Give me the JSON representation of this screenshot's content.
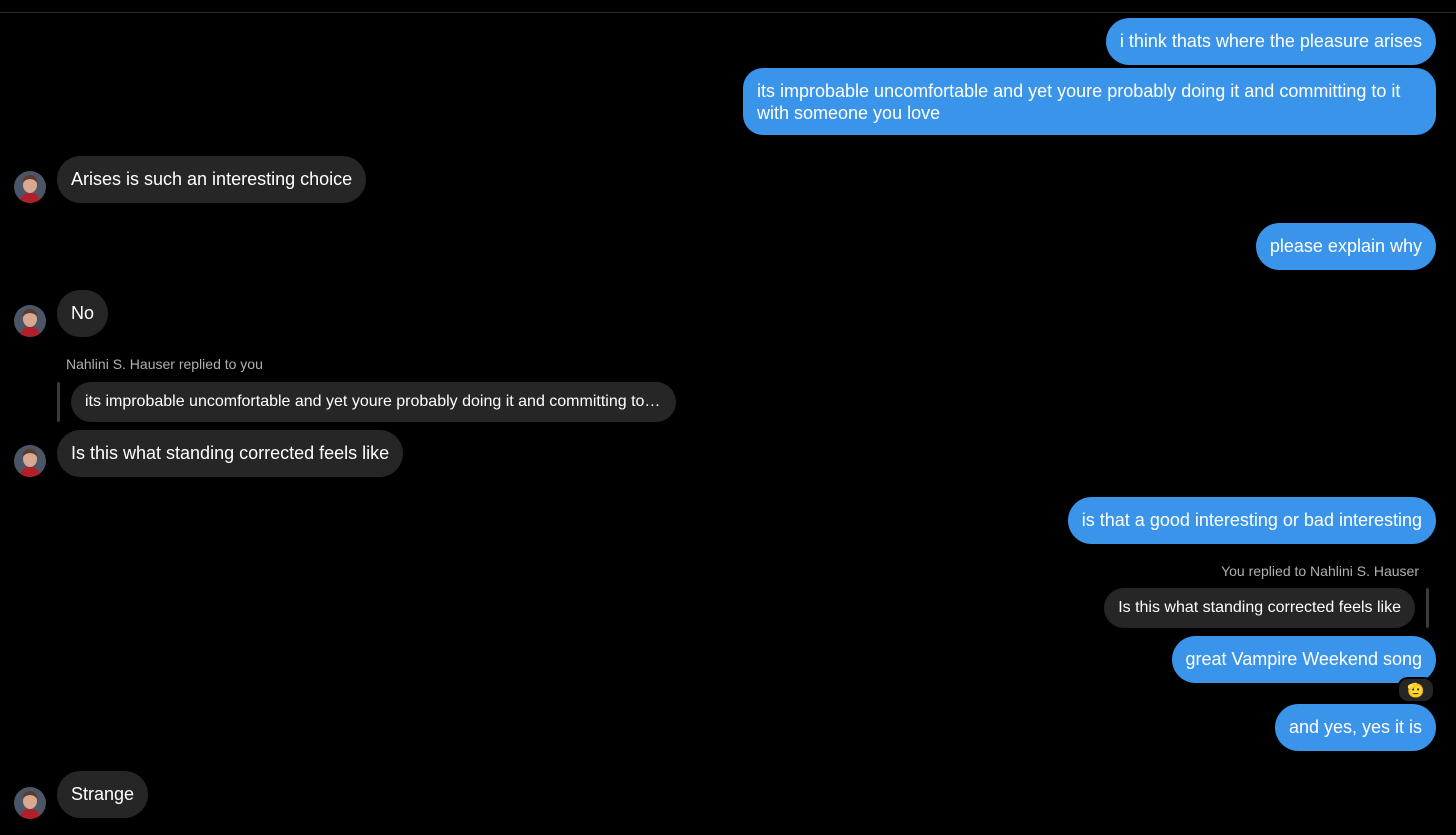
{
  "contact": {
    "name": "Nahlini S. Hauser"
  },
  "messages": {
    "m1": "i think thats where the pleasure arises",
    "m2": "its improbable uncomfortable and yet youre probably doing it and committing to it with someone you love",
    "m3": "Arises is such an interesting choice",
    "m4": "please explain why",
    "m5": "No",
    "m6_reply_label": "Nahlini S. Hauser replied to you",
    "m6_quote": "its improbable uncomfortable and yet youre probably doing it and committing to it with someone you love",
    "m6": "Is this what standing corrected feels like",
    "m7": "is that a good interesting or bad interesting",
    "m8_reply_label": "You replied to Nahlini S. Hauser",
    "m8_quote": "Is this what standing corrected feels like",
    "m8": "great Vampire Weekend song",
    "m8_reaction": "🫡",
    "m9": "and yes, yes it is",
    "m10": "Strange"
  },
  "colors": {
    "outgoing": "#3a95ea",
    "incoming": "#262626",
    "background": "#000000"
  },
  "icons": {
    "avatar": "contact-avatar-photo",
    "reaction": "saluting-face-emoji"
  }
}
